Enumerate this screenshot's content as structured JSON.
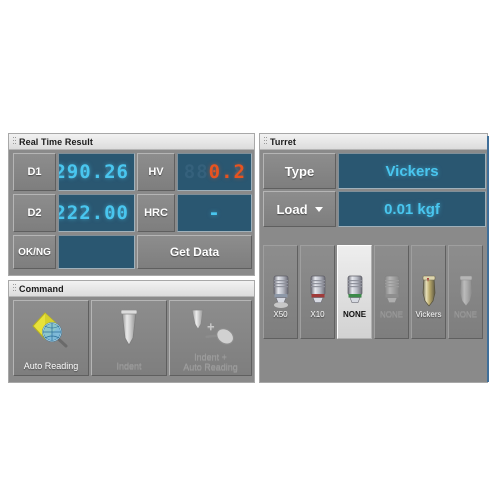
{
  "panels": {
    "real_time_result": {
      "title": "Real Time Result",
      "rows": {
        "d1": {
          "label": "D1",
          "value": "290.26",
          "ghost": "888.88",
          "unit_scale": "cyan"
        },
        "d2": {
          "label": "D2",
          "value": "222.00",
          "ghost": "888.88",
          "unit_scale": "cyan"
        },
        "hv": {
          "label": "HV",
          "value": "0.2",
          "ghost": "888.8",
          "unit_scale": "orange"
        },
        "hrc": {
          "label": "HRC",
          "value": "-",
          "ghost": "888.8",
          "unit_scale": "cyan"
        },
        "okng": {
          "label": "OK/NG",
          "value": ""
        }
      },
      "get_data_label": "Get Data"
    },
    "command": {
      "title": "Command",
      "buttons": [
        {
          "label": "Auto Reading",
          "icon": "diamond-magnifier-icon",
          "enabled": true
        },
        {
          "label": "Indent",
          "icon": "indenter-icon",
          "enabled": false
        },
        {
          "label": "Indent +\nAuto Reading",
          "label_line1": "Indent +",
          "label_line2": "Auto Reading",
          "icon": "indenter-plus-magnifier-icon",
          "enabled": false
        }
      ]
    },
    "turret": {
      "title": "Turret",
      "type": {
        "label": "Type",
        "value": "Vickers"
      },
      "load": {
        "label": "Load",
        "value": "0.01 kgf",
        "has_dropdown": true
      },
      "slots": [
        {
          "label": "X50",
          "kind": "objective",
          "band": "#8d98a8",
          "selected": false,
          "enabled": true
        },
        {
          "label": "X10",
          "kind": "objective",
          "band": "#a03a3a",
          "selected": false,
          "enabled": true
        },
        {
          "label": "NONE",
          "kind": "objective",
          "band": "#3c8a4a",
          "selected": true,
          "enabled": true
        },
        {
          "label": "NONE",
          "kind": "objective",
          "band": "#9a9a9a",
          "selected": false,
          "enabled": false
        },
        {
          "label": "Vickers",
          "kind": "indenter",
          "band": "#b09a4a",
          "selected": false,
          "enabled": true
        },
        {
          "label": "NONE",
          "kind": "indenter",
          "band": "#9a9a9a",
          "selected": false,
          "enabled": false
        }
      ]
    }
  },
  "colors": {
    "panel_bg": "#8a8a8a",
    "lcd_bg": "#2a5771",
    "lcd_cyan": "#49c6ef",
    "lcd_orange": "#e8531f",
    "accent_edge": "#3f6f9a"
  }
}
